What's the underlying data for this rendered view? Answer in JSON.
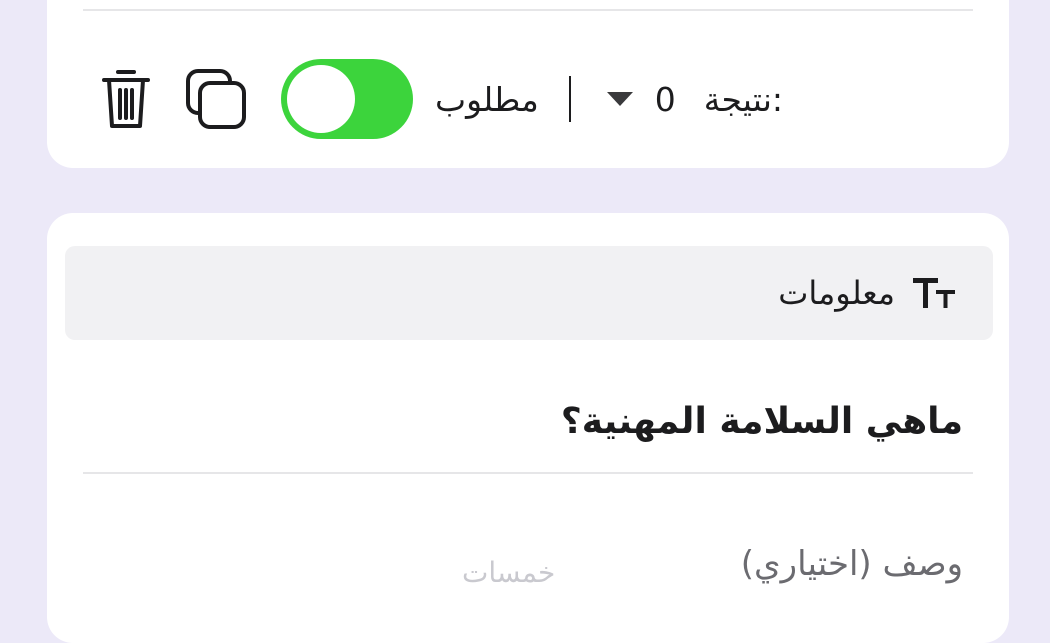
{
  "question_card": {
    "score_label": "نتيجة:",
    "score_value": "0",
    "required_label": "مطلوب",
    "required_on": true,
    "icons": {
      "score_dropdown": "caret-down-icon",
      "required_toggle": "toggle-switch",
      "duplicate": "copy-icon",
      "delete": "trash-icon"
    }
  },
  "info_card": {
    "type_icon": "text-size-icon",
    "type_label": "معلومات",
    "question_text": "ماهي السلامة  المهنية؟",
    "description_placeholder": "وصف (اختياري)"
  },
  "watermark": "خمسات",
  "colors": {
    "background": "#ece9f8",
    "card": "#ffffff",
    "toggle_on": "#3cd43c",
    "header_bg": "#f1f1f3",
    "text": "#1c1c1e",
    "muted": "#6b6b70"
  }
}
